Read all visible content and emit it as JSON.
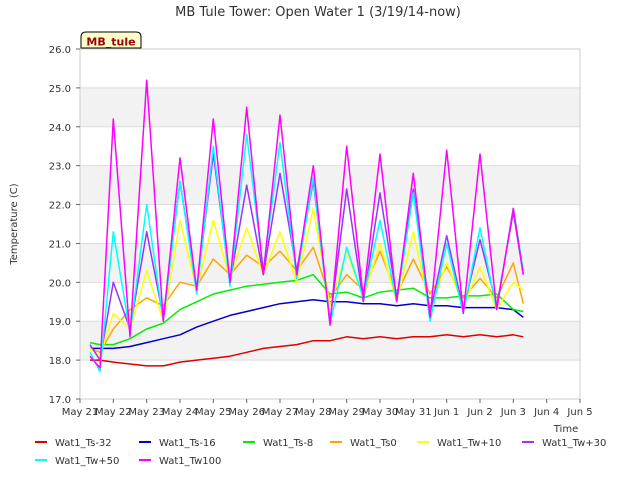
{
  "chart_data": {
    "type": "line",
    "title": "MB Tule Tower: Open Water 1 (3/19/14-now)",
    "xlabel": "Time",
    "ylabel": "Temperature (C)",
    "site_label": "MB_tule",
    "xlim": [
      21,
      36
    ],
    "ylim": [
      17.0,
      26.0
    ],
    "x_tick_values": [
      21,
      22,
      23,
      24,
      25,
      26,
      27,
      28,
      29,
      30,
      31,
      32,
      33,
      34,
      35,
      36
    ],
    "x_tick_labels": [
      "May 21",
      "May 22",
      "May 23",
      "May 24",
      "May 25",
      "May 26",
      "May 27",
      "May 28",
      "May 29",
      "May 30",
      "May 31",
      "Jun 1",
      "Jun 2",
      "Jun 3",
      "Jun 4",
      "Jun 5"
    ],
    "y_tick_values": [
      17.0,
      18.0,
      19.0,
      20.0,
      21.0,
      22.0,
      23.0,
      24.0,
      25.0,
      26.0
    ],
    "y_tick_labels": [
      "17.0",
      "18.0",
      "19.0",
      "20.0",
      "21.0",
      "22.0",
      "23.0",
      "24.0",
      "25.0",
      "26.0"
    ],
    "grid": true,
    "background_bands": true,
    "legend_position": "bottom",
    "x": [
      21.3,
      21.6,
      22.0,
      22.5,
      23.0,
      23.5,
      24.0,
      24.5,
      25.0,
      25.5,
      26.0,
      26.5,
      27.0,
      27.5,
      28.0,
      28.5,
      29.0,
      29.5,
      30.0,
      30.5,
      31.0,
      31.5,
      32.0,
      32.5,
      33.0,
      33.5,
      34.0,
      34.3
    ],
    "series": [
      {
        "name": "Wat1_Ts-32",
        "color": "#dd0000",
        "values": [
          18.0,
          18.0,
          17.95,
          17.9,
          17.85,
          17.85,
          17.95,
          18.0,
          18.05,
          18.1,
          18.2,
          18.3,
          18.35,
          18.4,
          18.5,
          18.5,
          18.6,
          18.55,
          18.6,
          18.55,
          18.6,
          18.6,
          18.65,
          18.6,
          18.65,
          18.6,
          18.65,
          18.6
        ]
      },
      {
        "name": "Wat1_Ts-16",
        "color": "#0000cc",
        "values": [
          18.3,
          18.3,
          18.3,
          18.35,
          18.45,
          18.55,
          18.65,
          18.85,
          19.0,
          19.15,
          19.25,
          19.35,
          19.45,
          19.5,
          19.55,
          19.5,
          19.5,
          19.45,
          19.45,
          19.4,
          19.45,
          19.4,
          19.4,
          19.35,
          19.35,
          19.35,
          19.3,
          19.1
        ]
      },
      {
        "name": "Wat1_Ts-8",
        "color": "#00ee00",
        "values": [
          18.45,
          18.4,
          18.4,
          18.55,
          18.8,
          18.95,
          19.3,
          19.5,
          19.7,
          19.8,
          19.9,
          19.95,
          20.0,
          20.05,
          20.2,
          19.7,
          19.75,
          19.6,
          19.75,
          19.8,
          19.85,
          19.6,
          19.6,
          19.65,
          19.65,
          19.7,
          19.3,
          19.25
        ]
      },
      {
        "name": "Wat1_Ts0",
        "color": "#ffa500",
        "values": [
          18.3,
          18.2,
          18.8,
          19.3,
          19.6,
          19.4,
          20.0,
          19.9,
          20.6,
          20.2,
          20.7,
          20.4,
          20.8,
          20.3,
          20.9,
          19.6,
          20.2,
          19.8,
          20.8,
          19.7,
          20.6,
          19.7,
          20.4,
          19.6,
          20.1,
          19.6,
          20.5,
          19.45
        ]
      },
      {
        "name": "Wat1_Tw+10",
        "color": "#ffff00",
        "values": [
          18.3,
          18.1,
          19.2,
          18.8,
          20.3,
          19.0,
          21.6,
          19.8,
          21.6,
          20.1,
          21.4,
          20.2,
          21.3,
          20.0,
          21.9,
          19.4,
          20.8,
          19.6,
          21.0,
          19.5,
          21.3,
          19.3,
          20.5,
          19.4,
          20.4,
          19.3,
          20.0,
          19.8
        ]
      },
      {
        "name": "Wat1_Tw+30",
        "color": "#9933ff",
        "values": [
          18.4,
          18.0,
          20.0,
          18.8,
          21.3,
          19.1,
          22.6,
          19.8,
          23.3,
          20.0,
          22.5,
          20.2,
          22.8,
          20.3,
          22.6,
          19.0,
          22.4,
          19.5,
          22.3,
          19.6,
          22.4,
          19.2,
          21.2,
          19.3,
          21.1,
          19.4,
          21.8,
          20.2
        ]
      },
      {
        "name": "Wat1_Tw+50",
        "color": "#00ffff",
        "values": [
          18.2,
          17.7,
          21.3,
          18.7,
          22.0,
          19.0,
          22.6,
          19.7,
          23.5,
          19.9,
          23.8,
          20.3,
          23.6,
          20.1,
          22.7,
          18.9,
          20.9,
          19.6,
          21.6,
          19.5,
          22.3,
          19.0,
          21.0,
          19.2,
          21.4,
          19.3,
          21.9,
          20.3
        ]
      },
      {
        "name": "Wat1_Tw100",
        "color": "#ff00ff",
        "values": [
          18.1,
          17.8,
          24.2,
          18.6,
          25.2,
          19.0,
          23.2,
          19.8,
          24.2,
          20.0,
          24.5,
          20.2,
          24.3,
          20.2,
          23.0,
          18.9,
          23.5,
          19.6,
          23.3,
          19.5,
          22.8,
          19.1,
          23.4,
          19.2,
          23.3,
          19.3,
          21.9,
          20.2
        ]
      }
    ]
  }
}
